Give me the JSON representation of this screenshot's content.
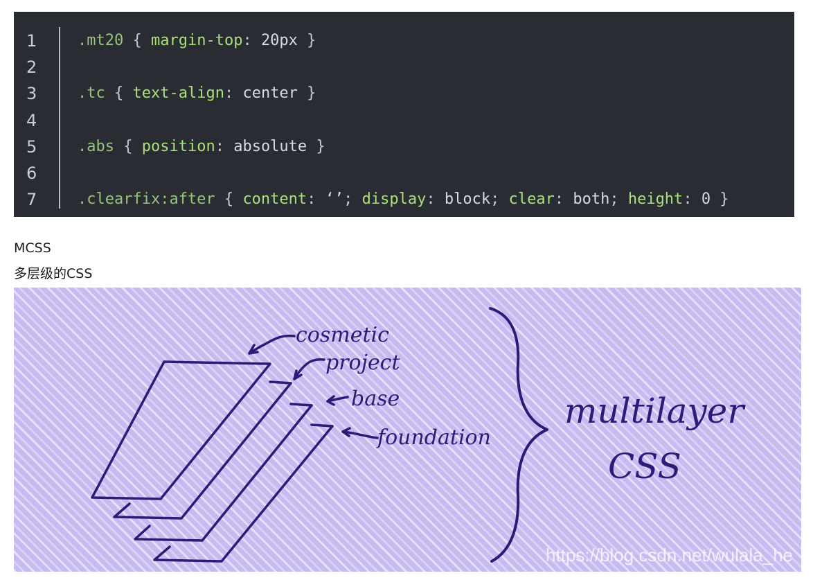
{
  "code": {
    "lines": [
      {
        "n": "1",
        "tokens": [
          {
            "t": ".mt20",
            "k": "sel"
          },
          {
            "t": " { ",
            "k": "punc"
          },
          {
            "t": "margin-top",
            "k": "prop"
          },
          {
            "t": ": ",
            "k": "punc"
          },
          {
            "t": "20px",
            "k": "val"
          },
          {
            "t": " }",
            "k": "punc"
          }
        ]
      },
      {
        "n": "2",
        "tokens": []
      },
      {
        "n": "3",
        "tokens": [
          {
            "t": ".tc",
            "k": "sel"
          },
          {
            "t": " { ",
            "k": "punc"
          },
          {
            "t": "text-align",
            "k": "prop"
          },
          {
            "t": ": ",
            "k": "punc"
          },
          {
            "t": "center",
            "k": "val"
          },
          {
            "t": " }",
            "k": "punc"
          }
        ]
      },
      {
        "n": "4",
        "tokens": []
      },
      {
        "n": "5",
        "tokens": [
          {
            "t": ".abs",
            "k": "sel"
          },
          {
            "t": " { ",
            "k": "punc"
          },
          {
            "t": "position",
            "k": "prop"
          },
          {
            "t": ": ",
            "k": "punc"
          },
          {
            "t": "absolute",
            "k": "val"
          },
          {
            "t": " }",
            "k": "punc"
          }
        ]
      },
      {
        "n": "6",
        "tokens": []
      },
      {
        "n": "7",
        "tokens": [
          {
            "t": ".clearfix:after",
            "k": "sel"
          },
          {
            "t": " { ",
            "k": "punc"
          },
          {
            "t": "content",
            "k": "prop"
          },
          {
            "t": ": ",
            "k": "punc"
          },
          {
            "t": "‘’",
            "k": "val"
          },
          {
            "t": "; ",
            "k": "punc"
          },
          {
            "t": "display",
            "k": "prop"
          },
          {
            "t": ": ",
            "k": "punc"
          },
          {
            "t": "block",
            "k": "val"
          },
          {
            "t": "; ",
            "k": "punc"
          },
          {
            "t": "clear",
            "k": "prop"
          },
          {
            "t": ": ",
            "k": "punc"
          },
          {
            "t": "both",
            "k": "val"
          },
          {
            "t": "; ",
            "k": "punc"
          },
          {
            "t": "height",
            "k": "prop"
          },
          {
            "t": ": ",
            "k": "punc"
          },
          {
            "t": "0",
            "k": "val"
          },
          {
            "t": " }",
            "k": "punc"
          }
        ]
      }
    ]
  },
  "heading": "MCSS",
  "subheading": "多层级的CSS",
  "illustration": {
    "layer_labels": {
      "cosmetic": "cosmetic",
      "project": "project",
      "base": "base",
      "foundation": "foundation"
    },
    "title_line1": "multilayer",
    "title_line2": "CSS",
    "watermark": "https://blog.csdn.net/wulala_he",
    "ink_color": "#2d1b78",
    "bg_color": "#c7baf0"
  }
}
